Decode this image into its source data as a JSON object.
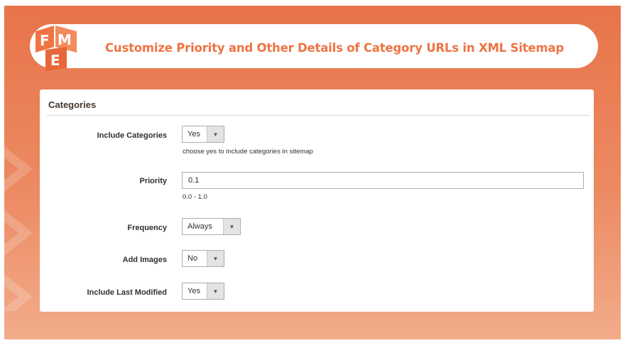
{
  "header": {
    "title": "Customize Priority and Other Details of Category URLs in XML Sitemap",
    "logo_letters": [
      "F",
      "M",
      "E"
    ]
  },
  "colors": {
    "brand_orange": "#ef7444",
    "frame_top": "#e8744a",
    "frame_bottom": "#f2ac8a"
  },
  "section": {
    "title": "Categories"
  },
  "fields": {
    "include_categories": {
      "label": "Include Categories",
      "value": "Yes",
      "note": "choose yes to include categories in sitemap"
    },
    "priority": {
      "label": "Priority",
      "value": "0.1",
      "note": "0.0 - 1.0"
    },
    "frequency": {
      "label": "Frequency",
      "value": "Always"
    },
    "add_images": {
      "label": "Add Images",
      "value": "No"
    },
    "include_last_modified": {
      "label": "Include Last Modified",
      "value": "Yes"
    }
  },
  "icons": {
    "dropdown": "chevron-down-icon"
  }
}
